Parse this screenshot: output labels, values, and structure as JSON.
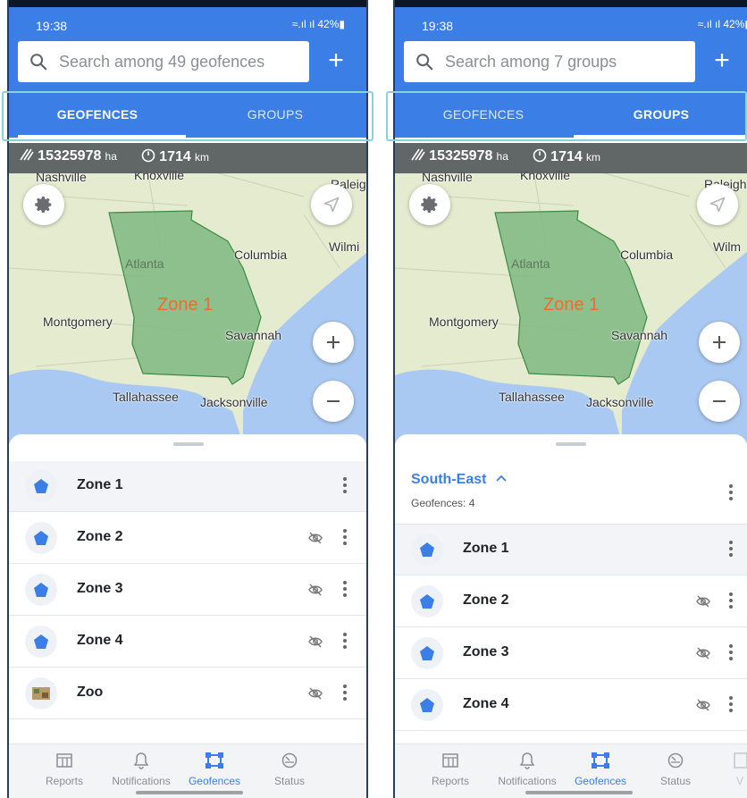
{
  "screens": [
    {
      "status_time": "19:38",
      "status_icons": "≈.ıl ıl 42%▮",
      "search_placeholder": "Search among 49 geofences",
      "tabs": [
        {
          "label": "GEOFENCES",
          "active": true
        },
        {
          "label": "GROUPS",
          "active": false
        }
      ],
      "stats": {
        "area_value": "15325978",
        "area_unit": "ha",
        "perimeter_value": "1714",
        "perimeter_unit": "km"
      },
      "map_labels": {
        "nashville": "Nashville",
        "knoxville": "Knoxville",
        "raleigh": "Raleigh",
        "columbia": "Columbia",
        "wilmington": "Wilmi",
        "atlanta": "Atlanta",
        "zone": "Zone 1",
        "montgomery": "Montgomery",
        "savannah": "Savannah",
        "tallahassee": "Tallahassee",
        "jacksonville": "Jacksonville"
      },
      "list": [
        {
          "name": "Zone 1",
          "icon": "pentagon-icon",
          "hidden": false,
          "selected": true
        },
        {
          "name": "Zone 2",
          "icon": "pentagon-icon",
          "hidden": true,
          "selected": false
        },
        {
          "name": "Zone 3",
          "icon": "pentagon-icon",
          "hidden": true,
          "selected": false
        },
        {
          "name": "Zone 4",
          "icon": "pentagon-icon",
          "hidden": true,
          "selected": false
        },
        {
          "name": "Zoo",
          "icon": "zoo-thumbnail",
          "hidden": true,
          "selected": false
        }
      ],
      "nav": [
        {
          "label": "Reports",
          "icon": "reports-icon",
          "active": false
        },
        {
          "label": "Notifications",
          "icon": "bell-icon",
          "active": false
        },
        {
          "label": "Geofences",
          "icon": "geofence-icon",
          "active": true
        },
        {
          "label": "Status",
          "icon": "status-icon",
          "active": false
        }
      ]
    },
    {
      "status_time": "19:38",
      "status_icons": "≈.ıl ıl 42%▮",
      "search_placeholder": "Search among 7 groups",
      "tabs": [
        {
          "label": "GEOFENCES",
          "active": false
        },
        {
          "label": "GROUPS",
          "active": true
        }
      ],
      "stats": {
        "area_value": "15325978",
        "area_unit": "ha",
        "perimeter_value": "1714",
        "perimeter_unit": "km"
      },
      "map_labels": {
        "nashville": "Nashville",
        "knoxville": "Knoxville",
        "raleigh": "Raleigh",
        "columbia": "Columbia",
        "wilmington": "Wilm",
        "atlanta": "Atlanta",
        "zone": "Zone 1",
        "montgomery": "Montgomery",
        "savannah": "Savannah",
        "tallahassee": "Tallahassee",
        "jacksonville": "Jacksonville"
      },
      "group": {
        "name": "South-East",
        "count_label": "Geofences: 4"
      },
      "list": [
        {
          "name": "Zone 1",
          "icon": "pentagon-icon",
          "hidden": false,
          "selected": true
        },
        {
          "name": "Zone 2",
          "icon": "pentagon-icon",
          "hidden": true,
          "selected": false
        },
        {
          "name": "Zone 3",
          "icon": "pentagon-icon",
          "hidden": true,
          "selected": false
        },
        {
          "name": "Zone 4",
          "icon": "pentagon-icon",
          "hidden": true,
          "selected": false
        }
      ],
      "nav": [
        {
          "label": "Reports",
          "icon": "reports-icon",
          "active": false
        },
        {
          "label": "Notifications",
          "icon": "bell-icon",
          "active": false
        },
        {
          "label": "Geofences",
          "icon": "geofence-icon",
          "active": true
        },
        {
          "label": "Status",
          "icon": "status-icon",
          "active": false
        },
        {
          "label": "V",
          "icon": "partial-icon",
          "active": false
        }
      ]
    }
  ],
  "colors": {
    "primary": "#3b7fe6",
    "zone_fill": "#7fb883",
    "zone_label": "#f36a2a",
    "water": "#a9c9f2",
    "highlight": "#86d3dc"
  }
}
